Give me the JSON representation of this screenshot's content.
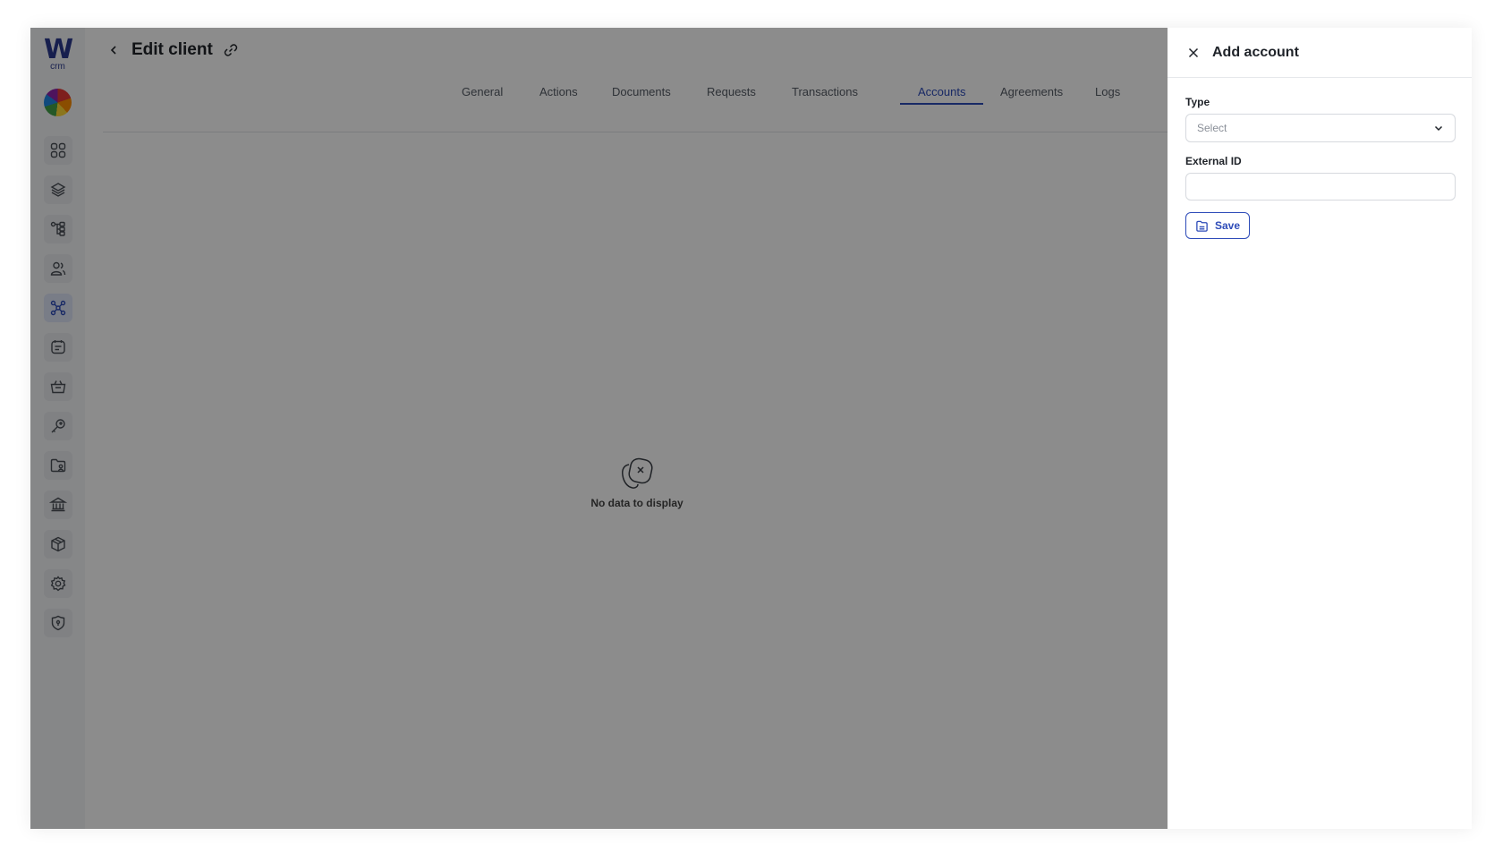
{
  "logo": {
    "mark": "W",
    "text": "crm"
  },
  "sidebar": {
    "items": [
      {
        "icon": "dashboard-grid-icon"
      },
      {
        "icon": "layers-icon"
      },
      {
        "icon": "hierarchy-icon"
      },
      {
        "icon": "users-icon"
      },
      {
        "icon": "clients-network-icon",
        "active": true
      },
      {
        "icon": "tasks-icon"
      },
      {
        "icon": "basket-icon"
      },
      {
        "icon": "key-icon"
      },
      {
        "icon": "folder-user-icon"
      },
      {
        "icon": "bank-icon"
      },
      {
        "icon": "box-icon"
      },
      {
        "icon": "settings-icon"
      },
      {
        "icon": "shield-icon"
      }
    ]
  },
  "header": {
    "title": "Edit client"
  },
  "tabs": [
    {
      "label": "General"
    },
    {
      "label": "Actions"
    },
    {
      "label": "Documents"
    },
    {
      "label": "Requests"
    },
    {
      "label": "Transactions"
    },
    {
      "label": "Accounts",
      "active": true
    },
    {
      "label": "Agreements"
    },
    {
      "label": "Logs"
    }
  ],
  "empty_state": {
    "message": "No data to display",
    "icon": "empty-data-icon"
  },
  "panel": {
    "title": "Add account",
    "type_label": "Type",
    "type_placeholder": "Select",
    "external_id_label": "External ID",
    "external_id_value": "",
    "save_label": "Save"
  },
  "colors": {
    "accent": "#2d4bb8",
    "overlay": "rgba(0,0,0,0.45)"
  }
}
